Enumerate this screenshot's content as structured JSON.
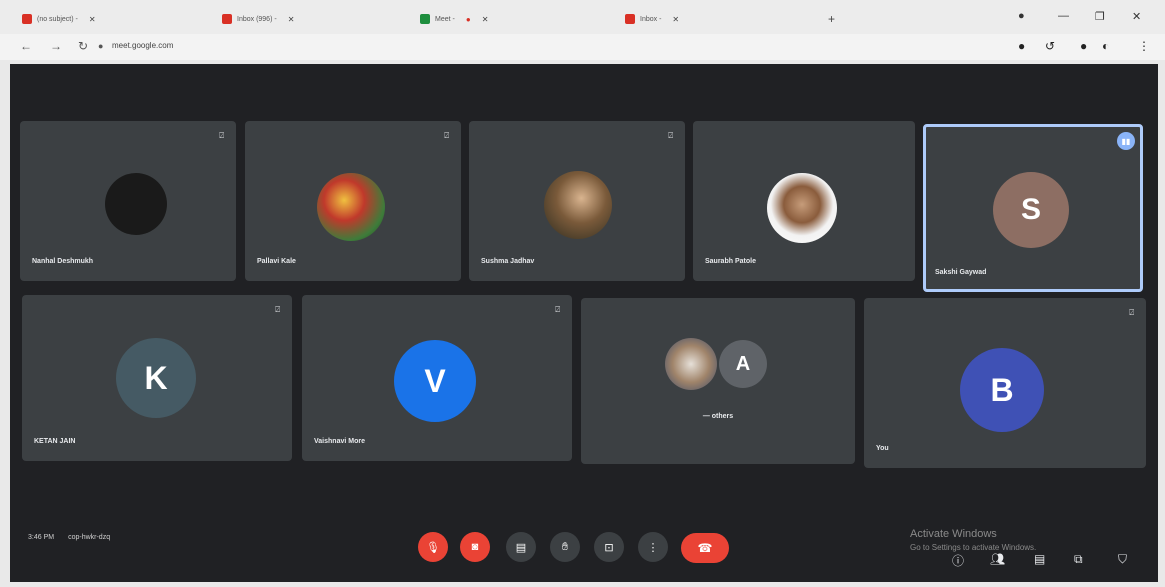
{
  "browser": {
    "tabs": [
      {
        "title": "(no subject) - ",
        "color": "#d93025"
      },
      {
        "title": "Inbox (996) - ",
        "color": "#d93025"
      },
      {
        "title": "Meet - ",
        "color": "#1e8e3e"
      },
      {
        "title": "",
        "color": "#d93025"
      },
      {
        "title": "Inbox - ",
        "color": "#d93025"
      }
    ],
    "url_host": "meet.google.com",
    "url_path": ""
  },
  "participants": [
    {
      "name": "Nanhal Deshmukh",
      "avatar": "",
      "avatar_color": "#1a1a1a"
    },
    {
      "name": "Pallavi Kale",
      "avatar": "photo",
      "avatar_color": "#6b8e3a"
    },
    {
      "name": "Sushma Jadhav",
      "avatar": "photo",
      "avatar_color": "#8a7a4a"
    },
    {
      "name": "Saurabh Patole",
      "avatar": "photo",
      "avatar_color": "#c9b8a0"
    },
    {
      "name": "Sakshi Gaywad",
      "avatar": "S",
      "avatar_color": "#8d6e63"
    },
    {
      "name": "KETAN JAIN",
      "avatar": "K",
      "avatar_color": "#455a64"
    },
    {
      "name": "Vaishnavi More",
      "avatar": "V",
      "avatar_color": "#1a73e8"
    },
    {
      "name": "— others",
      "avatar": "A",
      "avatar_color": "#5f6368"
    },
    {
      "name": "You",
      "avatar": "B",
      "avatar_color": "#3f51b5"
    }
  ],
  "meeting": {
    "time": "3:46 PM",
    "code": "cop-hwkr-dzq"
  },
  "watermark": {
    "line1": "Activate Windows",
    "line2": "Go to Settings to activate Windows."
  },
  "colors": {
    "stage_bg": "#202124",
    "tile_bg": "#3c4043",
    "danger": "#ea4335",
    "active_outline": "#aecbfa"
  }
}
